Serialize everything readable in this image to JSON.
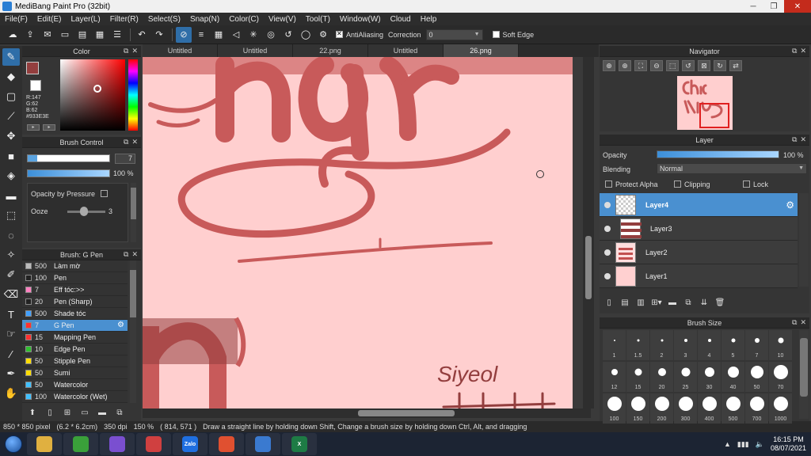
{
  "window": {
    "title": "MediBang Paint Pro (32bit)"
  },
  "menu": [
    "File(F)",
    "Edit(E)",
    "Layer(L)",
    "Filter(R)",
    "Select(S)",
    "Snap(N)",
    "Color(C)",
    "View(V)",
    "Tool(T)",
    "Window(W)",
    "Cloud",
    "Help"
  ],
  "toolbar": {
    "antialiasing_label": "AntiAliasing",
    "correction_label": "Correction",
    "correction_value": "0",
    "soft_edge_label": "Soft Edge"
  },
  "color_panel": {
    "title": "Color",
    "r": "R:147",
    "g": "G:62",
    "b": "B:62",
    "hex": "#933E3E",
    "fg_color": "#933e3e"
  },
  "brush_control": {
    "title": "Brush Control",
    "size_value": "7",
    "opacity_value": "100 %",
    "opacity_by_pressure_label": "Opacity by Pressure",
    "ooze_label": "Ooze",
    "ooze_value": "3"
  },
  "brush_list": {
    "title": "Brush: G Pen",
    "items": [
      {
        "size": "500",
        "name": "Làm mờ",
        "color": "#bbbbbb"
      },
      {
        "size": "100",
        "name": "Pen",
        "color": "#222222"
      },
      {
        "size": "7",
        "name": "Eff tóc:>>",
        "color": "#ff80c0"
      },
      {
        "size": "20",
        "name": "Pen (Sharp)",
        "color": "#222222"
      },
      {
        "size": "500",
        "name": "Shade tóc",
        "color": "#40a0ff"
      },
      {
        "size": "7",
        "name": "G Pen",
        "color": "#ff3030"
      },
      {
        "size": "15",
        "name": "Mapping Pen",
        "color": "#ff3030"
      },
      {
        "size": "10",
        "name": "Edge Pen",
        "color": "#30c030"
      },
      {
        "size": "50",
        "name": "Stipple Pen",
        "color": "#ffdd00"
      },
      {
        "size": "50",
        "name": "Sumi",
        "color": "#ffdd00"
      },
      {
        "size": "50",
        "name": "Watercolor",
        "color": "#40c0ff"
      },
      {
        "size": "100",
        "name": "Watercolor (Wet)",
        "color": "#40c0ff"
      }
    ]
  },
  "tabs": [
    "Untitled",
    "Untitled",
    "22.png",
    "Untitled",
    "26.png"
  ],
  "canvas": {
    "bg_color": "#ffcfcf",
    "stroke_color": "#c85a5a",
    "signature_text": "Siyeol"
  },
  "statusbar": {
    "size": "850 * 850 pixel",
    "cm": "(6.2 * 6.2cm)",
    "dpi": "350 dpi",
    "zoom": "150 %",
    "coords": "( 814, 571 )",
    "hint": "Draw a straight line by holding down Shift, Change a brush size by holding down Ctrl, Alt, and dragging"
  },
  "navigator": {
    "title": "Navigator"
  },
  "layer_panel": {
    "title": "Layer",
    "opacity_label": "Opacity",
    "opacity_value": "100 %",
    "blending_label": "Blending",
    "blending_value": "Normal",
    "protect_alpha_label": "Protect Alpha",
    "clipping_label": "Clipping",
    "lock_label": "Lock",
    "layers": [
      {
        "name": "Layer4",
        "thumb": "checker",
        "active": true
      },
      {
        "name": "Layer3",
        "thumb": "strip",
        "active": false
      },
      {
        "name": "Layer2",
        "thumb": "text",
        "active": false
      },
      {
        "name": "Layer1",
        "thumb": "pink",
        "active": false
      }
    ]
  },
  "brush_size": {
    "title": "Brush Size",
    "sizes": [
      "1",
      "1.5",
      "2",
      "3",
      "4",
      "5",
      "7",
      "10",
      "12",
      "15",
      "20",
      "25",
      "30",
      "40",
      "50",
      "70",
      "100",
      "150",
      "200",
      "300",
      "400",
      "500",
      "700",
      "1000"
    ]
  },
  "taskbar": {
    "time": "16:15 PM",
    "date": "08/07/2021",
    "lang": "ENG",
    "apps": [
      {
        "label": "",
        "color": "#e0b040"
      },
      {
        "label": "",
        "color": "#3aa03a"
      },
      {
        "label": "",
        "color": "#7a4fd0"
      },
      {
        "label": "",
        "color": "#d04040"
      },
      {
        "label": "Zalo",
        "color": "#1f6fe0"
      },
      {
        "label": "",
        "color": "#e05030"
      },
      {
        "label": "",
        "color": "#3a7ad0"
      },
      {
        "label": "X",
        "color": "#1e7b45"
      }
    ]
  }
}
